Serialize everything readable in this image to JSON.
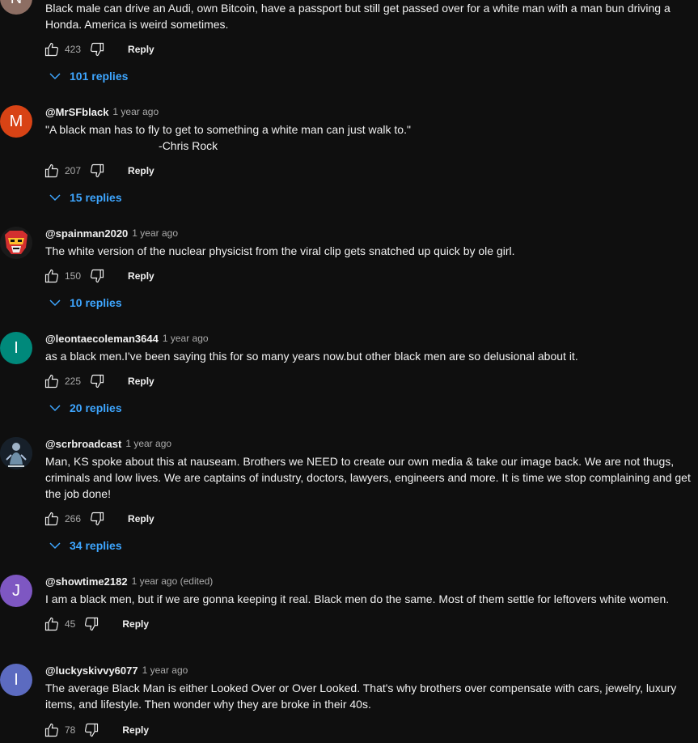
{
  "comments": [
    {
      "author": "",
      "time": "",
      "avatar_letter": "N",
      "avatar_color": "#8d6e63",
      "text": "Black male can drive an Audi, own Bitcoin, have a passport but still get passed over for a white man with a man bun driving a Honda. America is weird sometimes.",
      "likes": "423",
      "reply_label": "Reply",
      "replies_label": "101 replies"
    },
    {
      "author": "@MrSFblack",
      "time": "1 year ago",
      "avatar_letter": "M",
      "avatar_color": "#d84315",
      "text": "\"A black man has to fly to get to something a white man can just walk to.\"\n                                    -Chris Rock",
      "likes": "207",
      "reply_label": "Reply",
      "replies_label": "15 replies"
    },
    {
      "author": "@spainman2020",
      "time": "1 year ago",
      "avatar_icon": "voltron-helmet-icon",
      "text": "The white version of the nuclear physicist from the viral clip gets snatched up quick by ole girl.",
      "likes": "150",
      "reply_label": "Reply",
      "replies_label": "10 replies"
    },
    {
      "author": "@leontaecoleman3644",
      "time": "1 year ago",
      "avatar_letter": "I",
      "avatar_color": "#00897b",
      "text": "as a black men.I've been saying this for so many years now.but other black men are so delusional about it.",
      "likes": "225",
      "reply_label": "Reply",
      "replies_label": "20 replies"
    },
    {
      "author": "@scrbroadcast",
      "time": "1 year ago",
      "avatar_icon": "figure-photo-icon",
      "text": "Man, KS spoke about this at nauseam. Brothers we NEED to create our own media & take our image back. We are not thugs, criminals and low lives. We are captains of industry, doctors, lawyers, engineers and more. It is time we stop complaining and get the job done!",
      "likes": "266",
      "reply_label": "Reply",
      "replies_label": "34 replies"
    },
    {
      "author": "@showtime2182",
      "time": "1 year ago (edited)",
      "avatar_letter": "J",
      "avatar_color": "#7e57c2",
      "text": "I am a black men, but if we are gonna keeping it real. Black men do the same. Most of them settle for leftovers white women.",
      "likes": "45",
      "reply_label": "Reply"
    },
    {
      "author": "@luckyskivvy6077",
      "time": "1 year ago",
      "avatar_letter": "I",
      "avatar_color": "#5c6bc0",
      "text": "The average Black Man is either Looked Over or Over Looked. That's why brothers over compensate with cars, jewelry, luxury items, and lifestyle. Then wonder why they are broke in their 40s.",
      "likes": "78",
      "reply_label": "Reply"
    }
  ]
}
